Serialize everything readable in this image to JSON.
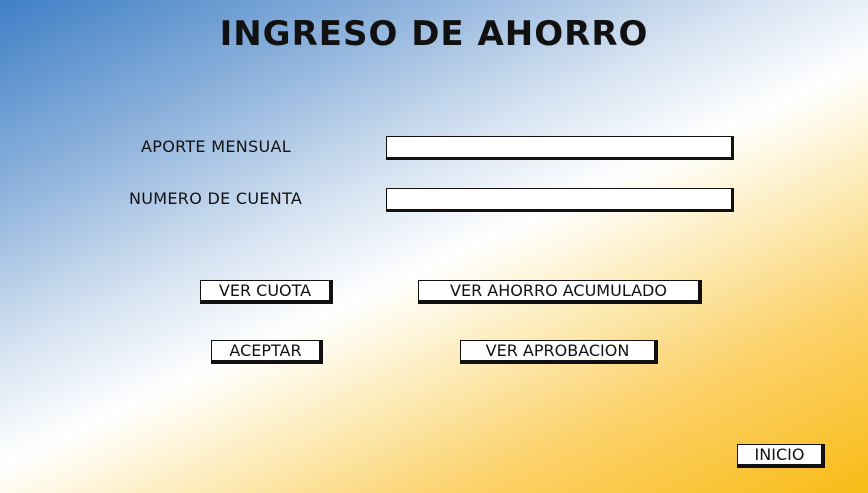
{
  "title": "INGRESO DE AHORRO",
  "form": {
    "monthly_contribution_label": "APORTE MENSUAL",
    "monthly_contribution_value": "",
    "account_number_label": "NUMERO DE CUENTA",
    "account_number_value": ""
  },
  "buttons": {
    "ver_cuota": "VER CUOTA",
    "ver_ahorro_acumulado": "VER AHORRO ACUMULADO",
    "aceptar": "ACEPTAR",
    "ver_aprobacion": "VER APROBACION",
    "inicio": "INICIO"
  },
  "colors": {
    "gradient_blue": "#3f7fc6",
    "gradient_white": "#ffffff",
    "gradient_yellow": "#f8bb16"
  }
}
